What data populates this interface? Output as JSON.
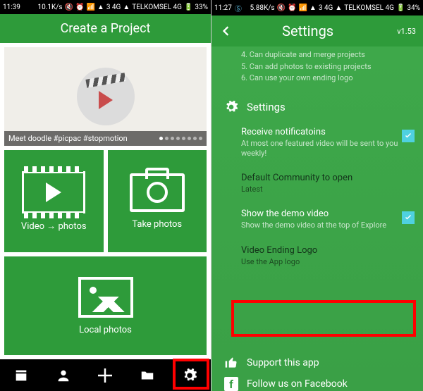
{
  "left": {
    "status": {
      "time": "11:39",
      "speed": "10.1K/s",
      "sim": "3 4G",
      "carrier": "TELKOMSEL 4G",
      "battery": "33%"
    },
    "header": {
      "title": "Create a Project"
    },
    "hero": {
      "caption": "Meet doodle  #picpac #stopmotion",
      "dot_count": 8,
      "active_dot": 0
    },
    "tiles": {
      "video": "Video → photos",
      "take": "Take photos",
      "local": "Local photos"
    },
    "nav_icons": [
      "film-icon",
      "people-icon",
      "plus-icon",
      "folder-icon",
      "gear-icon"
    ]
  },
  "right": {
    "status": {
      "time": "11:27",
      "speed": "5.88K/s",
      "sim": "3 4G",
      "carrier": "TELKOMSEL 4G",
      "battery": "34%"
    },
    "header": {
      "title": "Settings",
      "version": "v1.53"
    },
    "pro_features": [
      "4. Can duplicate and merge projects",
      "5. Can add photos to existing projects",
      "6. Can use your own ending logo"
    ],
    "section_label": "Settings",
    "items": [
      {
        "title": "Receive notificatoins",
        "sub": "At most one featured video will be sent to you weekly!",
        "checked": true
      },
      {
        "title": "Default Community to open",
        "sub": "Latest",
        "checked": false
      },
      {
        "title": "Show the demo video",
        "sub": "Show the demo video at the top of Explore",
        "checked": true
      },
      {
        "title": "Video Ending Logo",
        "sub": "Use the App logo",
        "checked": false
      }
    ],
    "support": {
      "title": "Support this app",
      "fb": "Follow us on Facebook"
    }
  }
}
